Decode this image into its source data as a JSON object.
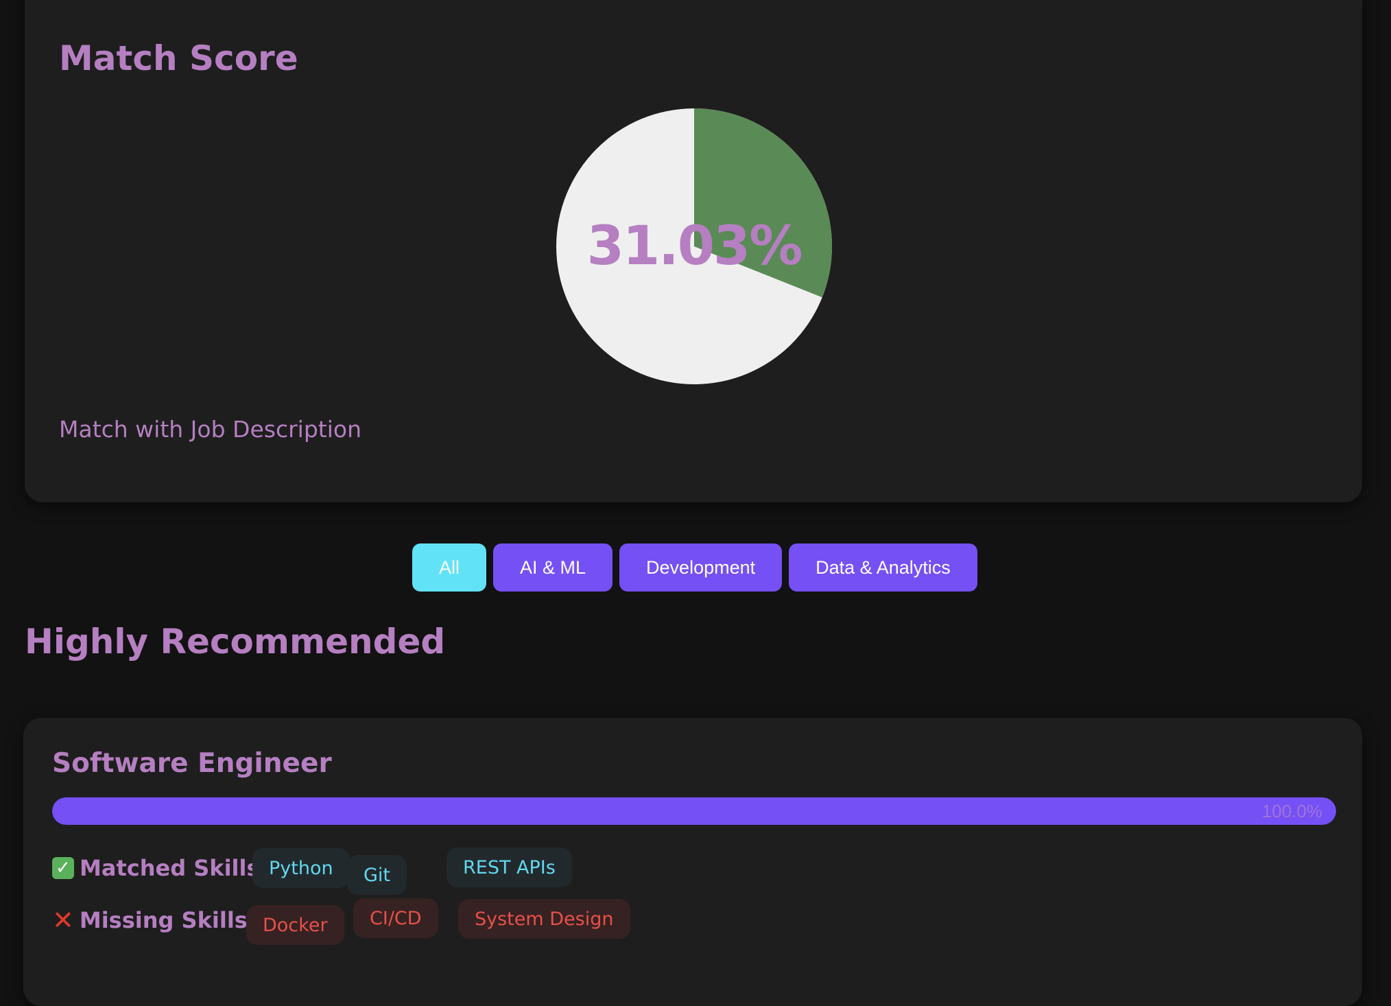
{
  "match_card": {
    "title": "Match Score",
    "score_label": "31.03%",
    "score_percent": 31.03,
    "caption": "Match with Job Description",
    "colors": {
      "match": "#5a8a56",
      "remainder": "#efefef",
      "text": "#b57fc1"
    }
  },
  "filters": [
    {
      "label": "All",
      "active": true
    },
    {
      "label": "AI & ML",
      "active": false
    },
    {
      "label": "Development",
      "active": false
    },
    {
      "label": "Data & Analytics",
      "active": false
    }
  ],
  "section_title": "Highly Recommended",
  "jobs": [
    {
      "title": "Software Engineer",
      "progress_percent": 100.0,
      "progress_label": "100.0%",
      "matched_label": "Matched Skills:",
      "matched_skills": [
        "Python",
        "Git",
        "REST APIs"
      ],
      "missing_label": "Missing Skills:",
      "missing_skills": [
        "Docker",
        "CI/CD",
        "System Design"
      ]
    }
  ],
  "icons": {
    "matched": "check-mark-icon",
    "missing": "cross-mark-icon"
  }
}
